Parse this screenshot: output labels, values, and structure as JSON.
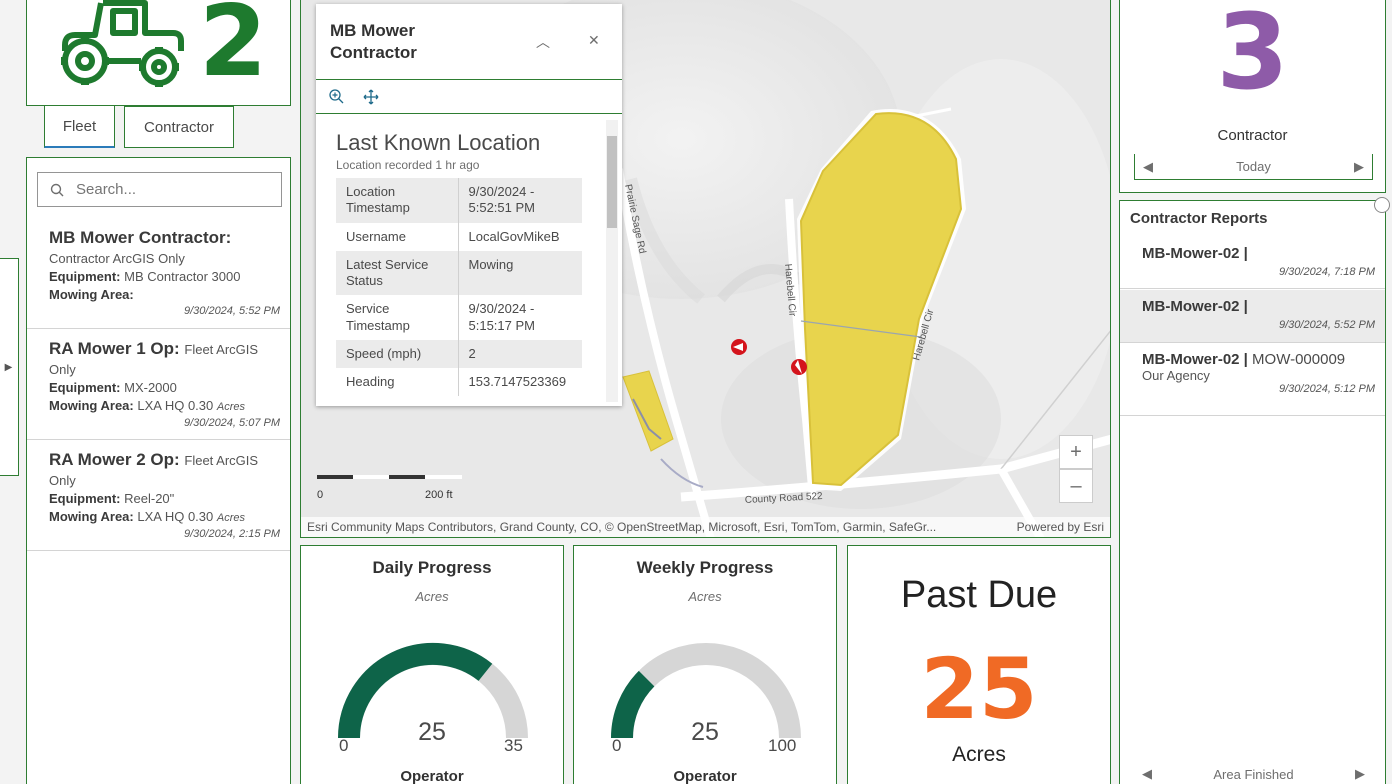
{
  "fleet": {
    "count": "2",
    "tabs": {
      "fleet": "Fleet",
      "contractor": "Contractor"
    }
  },
  "search": {
    "placeholder": "Search..."
  },
  "list": [
    {
      "title": "MB Mower Contractor:",
      "sub": "",
      "line2": "Contractor ArcGIS Only",
      "equipment_label": "Equipment:",
      "equipment": "MB Contractor 3000",
      "area_label": "Mowing Area:",
      "area": "",
      "acres": "",
      "date": "9/30/2024, 5:52 PM"
    },
    {
      "title": "RA Mower 1 Op:",
      "sub": "Fleet ArcGIS",
      "line2": "Only",
      "equipment_label": "Equipment:",
      "equipment": "MX-2000",
      "area_label": "Mowing Area:",
      "area": "LXA HQ  0.30",
      "acres": "Acres",
      "date": "9/30/2024, 5:07 PM"
    },
    {
      "title": "RA Mower 2 Op:",
      "sub": "Fleet ArcGIS",
      "line2": "Only",
      "equipment_label": "Equipment:",
      "equipment": "Reel-20\"",
      "area_label": "Mowing Area:",
      "area": "LXA HQ  0.30",
      "acres": "Acres",
      "date": "9/30/2024, 2:15 PM"
    }
  ],
  "map": {
    "roads": [
      "Prairie Sage Rd",
      "Harebell Cir",
      "Harebell Cir",
      "County Road 522"
    ],
    "scale": {
      "zero": "0",
      "distance": "200 ft"
    },
    "attribution": "Esri Community Maps Contributors, Grand County, CO, © OpenStreetMap, Microsoft, Esri, TomTom, Garmin, SafeGr...",
    "powered_by": "Powered by Esri",
    "zoom_in": "+",
    "zoom_out": "–"
  },
  "popup": {
    "title": "MB Mower Contractor",
    "heading": "Last Known Location",
    "subheading": "Location recorded 1 hr ago",
    "rows": [
      {
        "label": "Location Timestamp",
        "value": "9/30/2024 - 5:52:51 PM"
      },
      {
        "label": "Username",
        "value": "LocalGovMikeB"
      },
      {
        "label": "Latest Service Status",
        "value": "Mowing"
      },
      {
        "label": "Service Timestamp",
        "value": "9/30/2024 - 5:15:17 PM"
      },
      {
        "label": "Speed (mph)",
        "value": "2"
      },
      {
        "label": "Heading",
        "value": "153.7147523369"
      }
    ]
  },
  "gauges": [
    {
      "title": "Daily Progress",
      "sub": "Acres",
      "value": 25,
      "min": 0,
      "max": 35,
      "value_text": "25",
      "min_text": "0",
      "max_text": "35",
      "footer": "Operator"
    },
    {
      "title": "Weekly Progress",
      "sub": "Acres",
      "value": 25,
      "min": 0,
      "max": 100,
      "value_text": "25",
      "min_text": "0",
      "max_text": "100",
      "footer": "Operator"
    }
  ],
  "past_due": {
    "title": "Past Due",
    "value": "25",
    "unit": "Acres"
  },
  "contractor": {
    "count": "3",
    "label": "Contractor",
    "period": "Today"
  },
  "reports": {
    "title": "Contractor Reports",
    "items": [
      {
        "title": "MB-Mower-02 |",
        "id": "",
        "sub": "",
        "date": "9/30/2024, 7:18 PM"
      },
      {
        "title": "MB-Mower-02 |",
        "id": "",
        "sub": "",
        "date": "9/30/2024, 5:52 PM"
      },
      {
        "title": "MB-Mower-02 |",
        "id": " MOW-000009",
        "sub": "Our Agency",
        "date": "9/30/2024, 5:12 PM"
      }
    ],
    "footer_nav": "Area Finished"
  },
  "colors": {
    "accent": "#2e7d32",
    "fleet": "#1e7a2e",
    "contractor": "#8e5ba8",
    "past_due": "#f06a25",
    "gauge_fill": "#0e6449",
    "polygon": "#e8d44d"
  }
}
